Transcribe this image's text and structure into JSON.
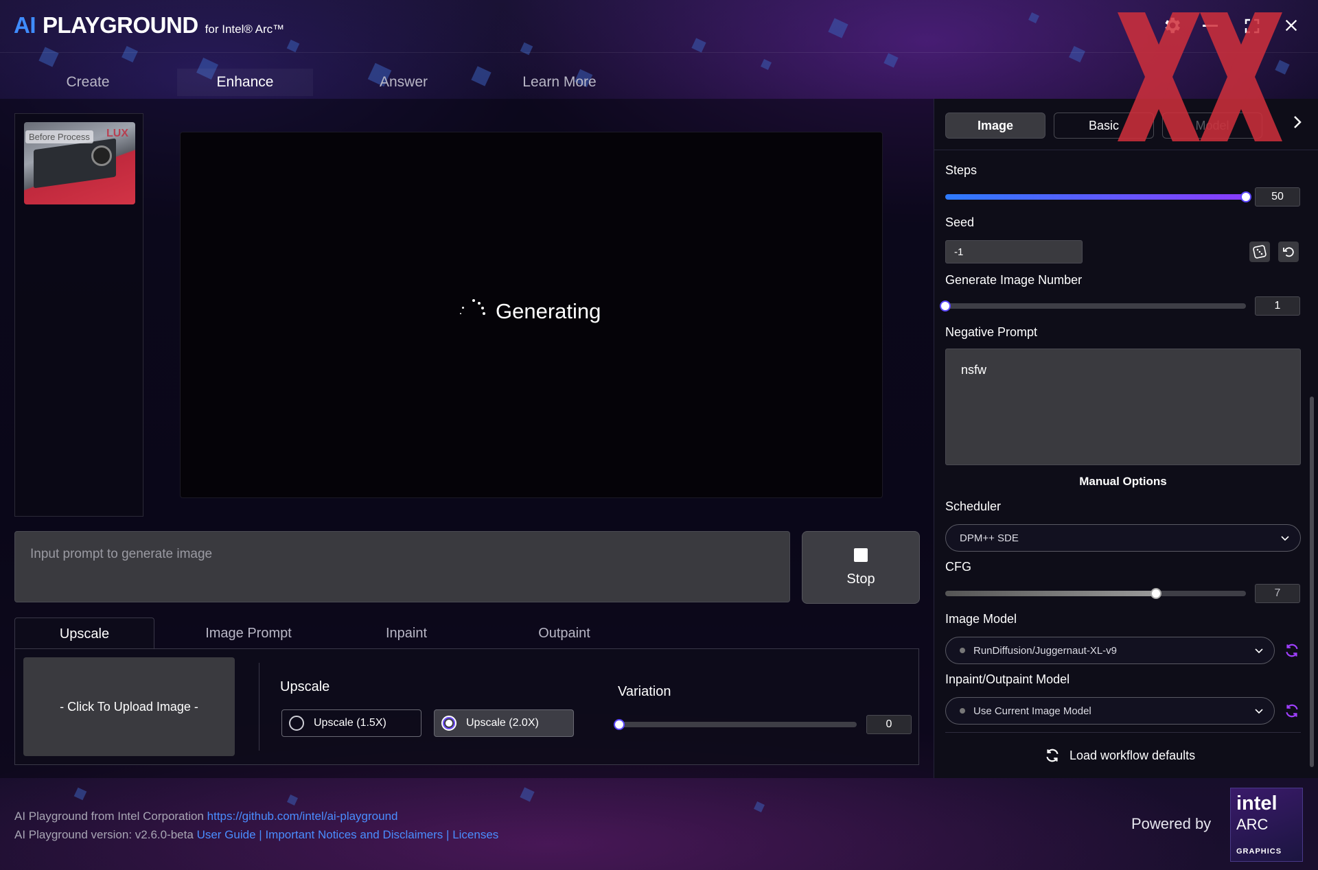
{
  "header": {
    "logo_ai": "AI",
    "logo_playground": "PLAYGROUND",
    "logo_sub": "for Intel® Arc™",
    "watermark": "XX"
  },
  "main_tabs": [
    {
      "label": "Create"
    },
    {
      "label": "Enhance"
    },
    {
      "label": "Answer"
    },
    {
      "label": "Learn More"
    }
  ],
  "thumbnail": {
    "label": "Before Process",
    "overlay": "LUX"
  },
  "canvas": {
    "status": "Generating"
  },
  "prompt": {
    "placeholder": "Input prompt to generate image"
  },
  "stop_button": {
    "label": "Stop"
  },
  "sub_tabs": [
    {
      "label": "Upscale"
    },
    {
      "label": "Image Prompt"
    },
    {
      "label": "Inpaint"
    },
    {
      "label": "Outpaint"
    }
  ],
  "upscale_panel": {
    "upload_label": "- Click To Upload Image -",
    "upscale_title": "Upscale",
    "options": [
      {
        "label": "Upscale (1.5X)",
        "selected": false
      },
      {
        "label": "Upscale (2.0X)",
        "selected": true
      }
    ],
    "variation_title": "Variation",
    "variation_value": "0",
    "variation_fraction": 0
  },
  "footer": {
    "line1_text": "AI Playground from Intel Corporation",
    "line1_link": "https://github.com/intel/ai-playground",
    "line2_text": "AI Playground version: v2.6.0-beta",
    "link_user_guide": "User Guide",
    "sep": "|",
    "link_notices": "Important Notices and Disclaimers",
    "link_licenses": "Licenses",
    "powered_by": "Powered by",
    "badge_intel": "intel",
    "badge_arc": "ARC",
    "badge_graphics": "GRAPHICS"
  },
  "right_panel": {
    "tabs": [
      {
        "label": "Image"
      },
      {
        "label": "Basic"
      },
      {
        "label": "Model"
      }
    ],
    "steps": {
      "label": "Steps",
      "value": "50",
      "fraction": 1.0
    },
    "seed": {
      "label": "Seed",
      "value": "-1"
    },
    "image_number": {
      "label": "Generate Image Number",
      "value": "1",
      "fraction": 0
    },
    "negative_prompt": {
      "label": "Negative Prompt",
      "value": "nsfw"
    },
    "manual_options": "Manual Options",
    "scheduler": {
      "label": "Scheduler",
      "value": "DPM++ SDE"
    },
    "cfg": {
      "label": "CFG",
      "value": "7",
      "fraction": 0.7
    },
    "image_model": {
      "label": "Image Model",
      "value": "RunDiffusion/Juggernaut-XL-v9"
    },
    "inpaint_model": {
      "label": "Inpaint/Outpaint Model",
      "value": "Use Current Image Model"
    },
    "load_defaults": "Load workflow defaults"
  },
  "colors": {
    "accent_blue": "#3f8cff",
    "slider_gradient_start": "#2d7bff",
    "slider_gradient_end": "#8a3cff",
    "link": "#4a8dff",
    "watermark_red": "#d0303c"
  }
}
